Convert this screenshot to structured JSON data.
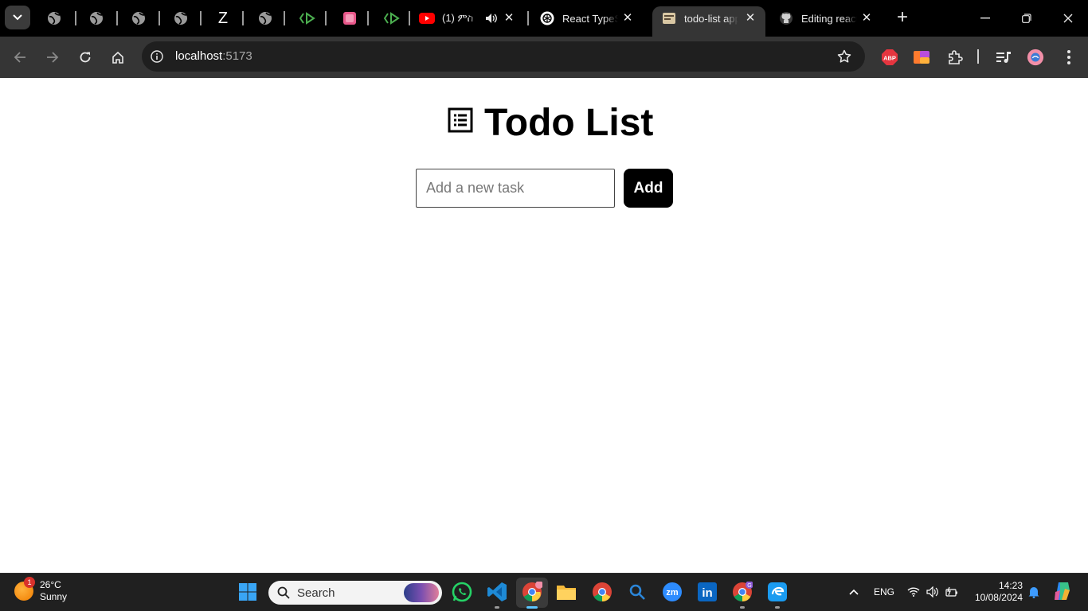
{
  "browser": {
    "tabs": [
      {
        "title": "(1) ምስ",
        "favicon": "youtube-icon",
        "audio": true
      },
      {
        "title": "React TypeSc",
        "favicon": "chatgpt-icon"
      },
      {
        "title": "todo-list app",
        "favicon": "app-icon",
        "active": true
      },
      {
        "title": "Editing react",
        "favicon": "github-icon"
      }
    ],
    "pinned_label_z": "Z",
    "new_tab": "+",
    "url_host": "localhost",
    "url_port": ":5173",
    "extensions": {
      "abp_label": "ABP"
    }
  },
  "page": {
    "heading": "Todo List",
    "input_placeholder": "Add a new task",
    "input_value": "",
    "add_label": "Add"
  },
  "taskbar": {
    "weather": {
      "temp": "26°C",
      "condition": "Sunny",
      "badge": "1"
    },
    "search_label": "Search",
    "zoom_label": "zm",
    "linkedin_label": "in",
    "profile_badge": "G",
    "language": "ENG",
    "time": "14:23",
    "date": "10/08/2024"
  },
  "colors": {
    "tabstrip_bg": "#000000",
    "toolbar_bg": "#353535",
    "button_bg": "#000000",
    "taskbar_bg": "#202020"
  }
}
